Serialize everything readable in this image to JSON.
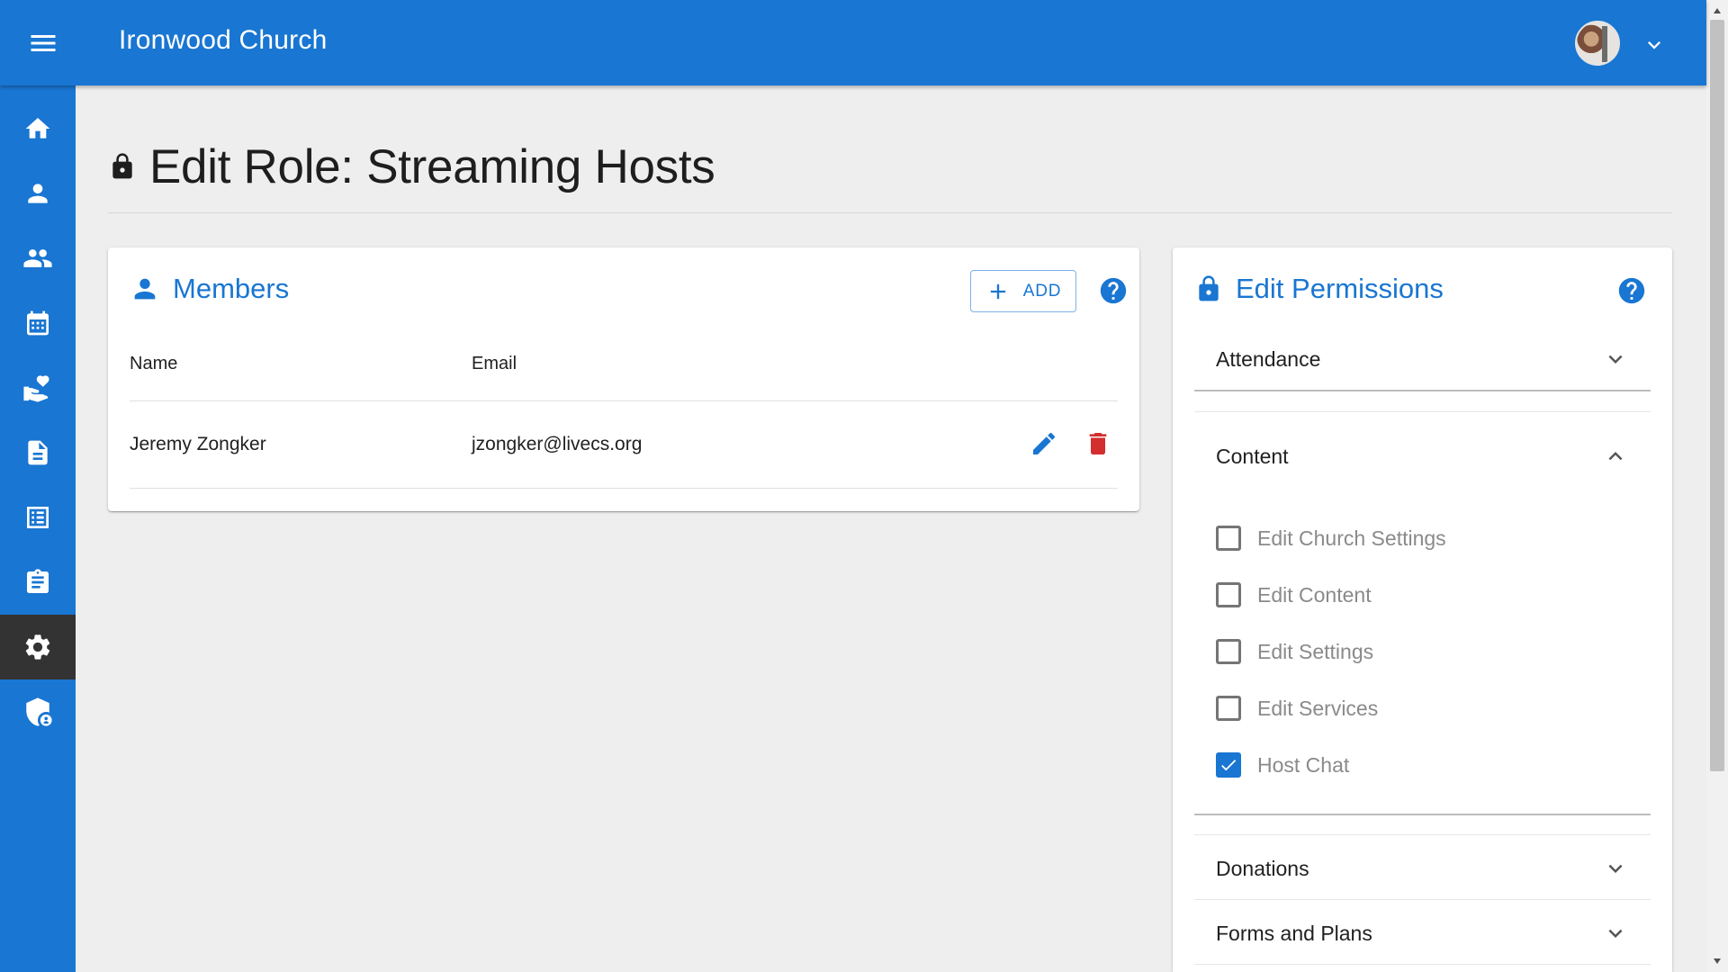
{
  "app": {
    "title": "Ironwood Church"
  },
  "sidebar": {
    "items": [
      {
        "icon": "home-icon"
      },
      {
        "icon": "person-icon"
      },
      {
        "icon": "people-icon"
      },
      {
        "icon": "calendar-icon"
      },
      {
        "icon": "donation-icon"
      },
      {
        "icon": "document-icon"
      },
      {
        "icon": "list-icon"
      },
      {
        "icon": "clipboard-icon"
      },
      {
        "icon": "gear-icon",
        "active": true
      },
      {
        "icon": "security-shield-icon"
      }
    ]
  },
  "page": {
    "title": "Edit Role: Streaming Hosts"
  },
  "members": {
    "title": "Members",
    "add_label": "ADD",
    "columns": [
      "Name",
      "Email"
    ],
    "rows": [
      {
        "name": "Jeremy Zongker",
        "email": "jzongker@livecs.org"
      }
    ]
  },
  "permissions": {
    "title": "Edit Permissions",
    "sections": [
      {
        "label": "Attendance",
        "expanded": false
      },
      {
        "label": "Content",
        "expanded": true,
        "items": [
          {
            "label": "Edit Church Settings",
            "checked": false
          },
          {
            "label": "Edit Content",
            "checked": false
          },
          {
            "label": "Edit Settings",
            "checked": false
          },
          {
            "label": "Edit Services",
            "checked": false
          },
          {
            "label": "Host Chat",
            "checked": true
          }
        ]
      },
      {
        "label": "Donations",
        "expanded": false
      },
      {
        "label": "Forms and Plans",
        "expanded": false
      }
    ]
  },
  "colors": {
    "primary": "#1976d2",
    "danger": "#d32f2f",
    "sidebar_active": "#333333"
  }
}
